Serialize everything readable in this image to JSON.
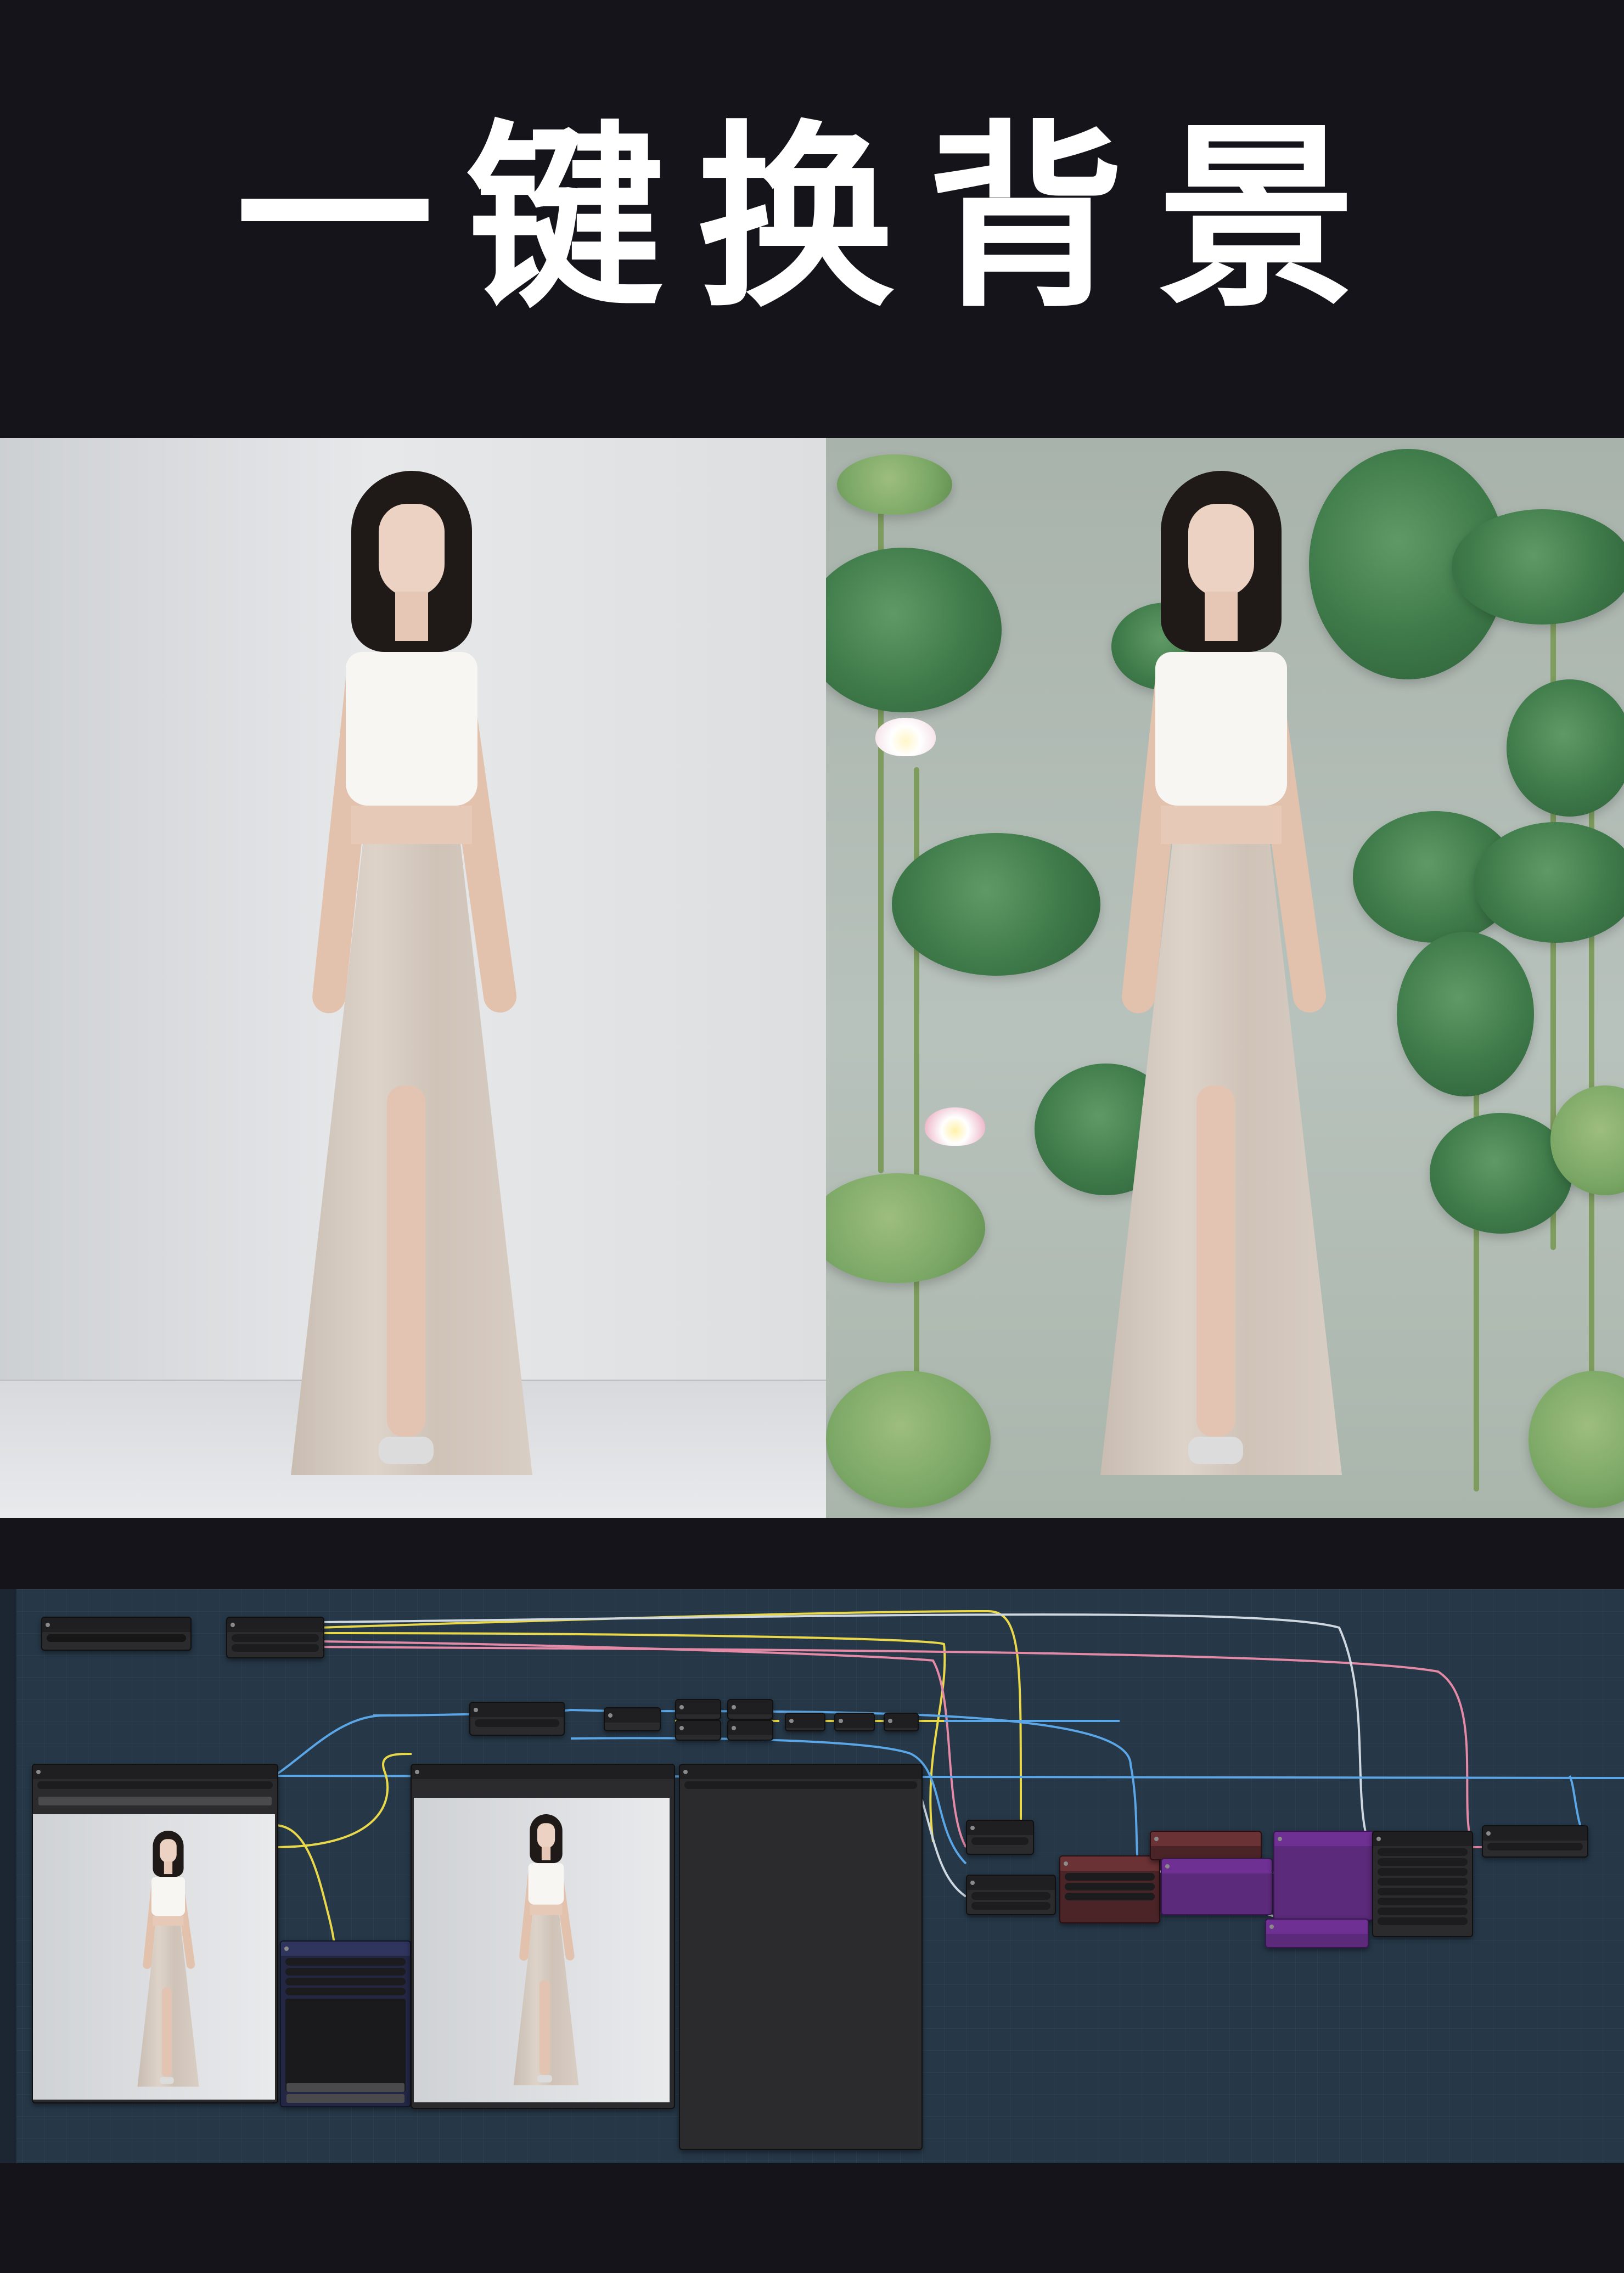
{
  "hero": {
    "title": "一键换背景"
  },
  "colors": {
    "page_background": "#15141b",
    "title_text": "#ffffff",
    "canvas_background": "#263848",
    "node_body": "#2b2b2d",
    "node_purple": "#5b2a7a",
    "node_maroon": "#4a2426",
    "node_navy": "#232744",
    "wire_yellow": "#e8d84a",
    "wire_pink": "#e58aa6",
    "wire_blue": "#5aa6e6",
    "wire_white": "#cfd8e0"
  },
  "comparison": {
    "before": "original-photo-white-studio",
    "after": "generated-photo-lotus-leaves"
  },
  "icons": [
    "node-collapse-dot-icon"
  ]
}
